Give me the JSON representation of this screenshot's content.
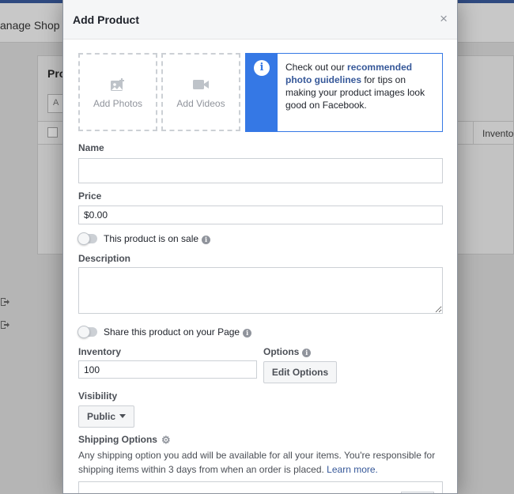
{
  "background": {
    "header_title": "anage Shop",
    "panel_title": "Pro",
    "panel_button_label": "A",
    "inventory_column": "Invento"
  },
  "dialog": {
    "title": "Add Product",
    "close": "×",
    "media": {
      "add_photos": "Add Photos",
      "add_videos": "Add Videos"
    },
    "tip": {
      "prefix": "Check out our ",
      "link": "recommended photo guidelines",
      "suffix": " for tips on making your product images look good on Facebook."
    },
    "name": {
      "label": "Name",
      "value": "",
      "placeholder": ""
    },
    "price": {
      "label": "Price",
      "value": "$0.00"
    },
    "sale_toggle": {
      "label": "This product is on sale",
      "on": false
    },
    "description": {
      "label": "Description",
      "value": ""
    },
    "share_toggle": {
      "label": "Share this product on your Page",
      "on": false
    },
    "inventory": {
      "label": "Inventory",
      "value": "100"
    },
    "options": {
      "label": "Options",
      "button": "Edit Options"
    },
    "visibility": {
      "label": "Visibility",
      "selected": "Public"
    },
    "shipping": {
      "label": "Shipping Options",
      "description": "Any shipping option you add will be available for all your items. You're responsible for shipping items within 3 days from when an order is placed.",
      "learn_more": "Learn more."
    }
  },
  "colors": {
    "accent": "#3578e5",
    "link": "#365899",
    "border": "#ccd0d5",
    "muted_text": "#90949c"
  },
  "icons": [
    "close-icon",
    "photo-icon",
    "video-icon",
    "info-icon",
    "gear-icon",
    "caret-down-icon",
    "export-icon"
  ]
}
